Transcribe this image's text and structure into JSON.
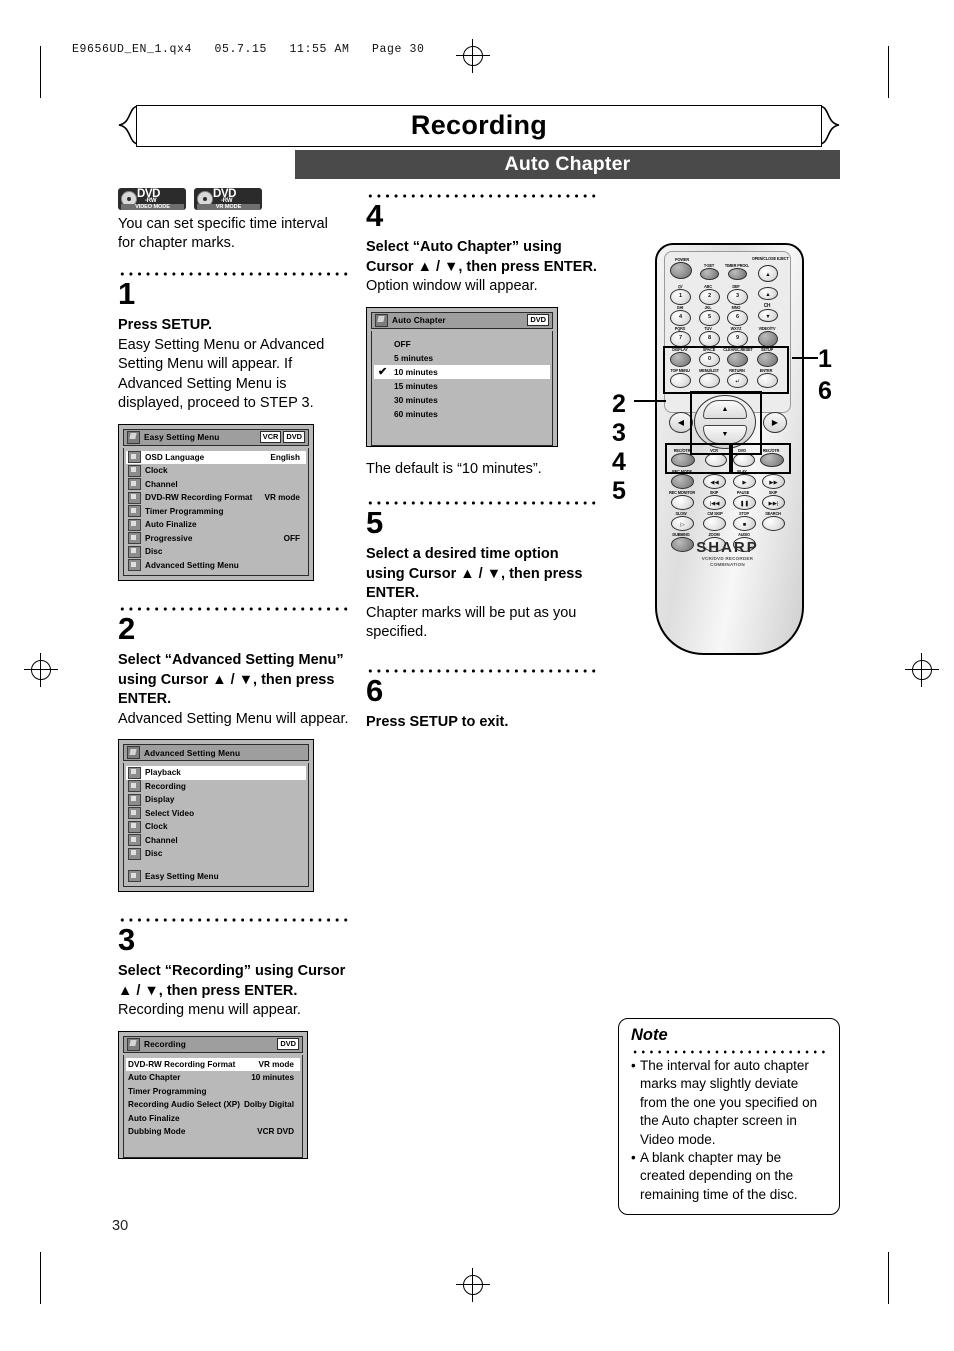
{
  "print_header": "E9656UD_EN_1.qx4   05.7.15   11:55 AM   Page 30",
  "page_number": "30",
  "header": {
    "chapter_title": "Recording",
    "section_title": "Auto Chapter"
  },
  "media_logos": [
    {
      "top": "DVD",
      "mid": "-RW",
      "bottom": "VIDEO MODE"
    },
    {
      "top": "DVD",
      "mid": "-RW",
      "bottom": "VR MODE"
    }
  ],
  "intro": "You can set specific time interval for chapter marks.",
  "steps": [
    {
      "number": "1",
      "bold": "Press SETUP.",
      "body": "Easy Setting Menu or Advanced Setting Menu will appear. If Advanced Setting Menu is displayed, proceed to STEP 3."
    },
    {
      "number": "2",
      "bold": "Select “Advanced Setting Menu” using Cursor ▲ / ▼, then press ENTER.",
      "body": "Advanced Setting Menu will appear."
    },
    {
      "number": "3",
      "bold": "Select “Recording” using Cursor ▲ / ▼, then press ENTER.",
      "body": "Recording menu will appear."
    },
    {
      "number": "4",
      "bold": "Select “Auto Chapter” using Cursor ▲ / ▼, then press ENTER.",
      "body": "Option window will appear."
    },
    {
      "number": "5",
      "bold": "Select a desired time option using Cursor ▲ / ▼, then press ENTER.",
      "body": "Chapter marks will be put as you specified."
    },
    {
      "number": "6",
      "bold": "Press SETUP to exit.",
      "body": ""
    }
  ],
  "default_note": "The default is “10 minutes”.",
  "screens": {
    "easy_setting": {
      "title": "Easy Setting Menu",
      "tags": [
        "VCR",
        "DVD"
      ],
      "rows": [
        {
          "label": "OSD Language",
          "value": "English",
          "selected": true
        },
        {
          "label": "Clock",
          "value": "",
          "selected": false
        },
        {
          "label": "Channel",
          "value": "",
          "selected": false
        },
        {
          "label": "DVD-RW Recording Format",
          "value": "VR mode",
          "selected": false
        },
        {
          "label": "Timer Programming",
          "value": "",
          "selected": false
        },
        {
          "label": "Auto Finalize",
          "value": "",
          "selected": false
        },
        {
          "label": "Progressive",
          "value": "OFF",
          "selected": false
        },
        {
          "label": "Disc",
          "value": "",
          "selected": false
        },
        {
          "label": "Advanced Setting Menu",
          "value": "",
          "selected": false
        }
      ]
    },
    "advanced_setting": {
      "title": "Advanced Setting Menu",
      "tags": [],
      "rows": [
        {
          "label": "Playback",
          "value": "",
          "selected": true
        },
        {
          "label": "Recording",
          "value": "",
          "selected": false
        },
        {
          "label": "Display",
          "value": "",
          "selected": false
        },
        {
          "label": "Select Video",
          "value": "",
          "selected": false
        },
        {
          "label": "Clock",
          "value": "",
          "selected": false
        },
        {
          "label": "Channel",
          "value": "",
          "selected": false
        },
        {
          "label": "Disc",
          "value": "",
          "selected": false
        },
        {
          "label": "",
          "value": "",
          "selected": false
        },
        {
          "label": "Easy Setting Menu",
          "value": "",
          "selected": false
        }
      ]
    },
    "recording": {
      "title": "Recording",
      "tags": [
        "DVD"
      ],
      "rows": [
        {
          "label": "DVD-RW Recording Format",
          "value": "VR mode",
          "selected": true
        },
        {
          "label": "Auto Chapter",
          "value": "10 minutes",
          "selected": false
        },
        {
          "label": "Timer Programming",
          "value": "",
          "selected": false
        },
        {
          "label": "Recording Audio Select (XP)",
          "value": "Dolby Digital",
          "selected": false
        },
        {
          "label": "Auto Finalize",
          "value": "",
          "selected": false
        },
        {
          "label": "Dubbing Mode",
          "value": "VCR DVD",
          "selected": false
        }
      ]
    },
    "auto_chapter": {
      "title": "Auto Chapter",
      "tags": [
        "DVD"
      ],
      "options": [
        {
          "label": "OFF",
          "selected": false,
          "checked": false
        },
        {
          "label": "5 minutes",
          "selected": false,
          "checked": false
        },
        {
          "label": "10 minutes",
          "selected": true,
          "checked": true
        },
        {
          "label": "15 minutes",
          "selected": false,
          "checked": false
        },
        {
          "label": "30 minutes",
          "selected": false,
          "checked": false
        },
        {
          "label": "60 minutes",
          "selected": false,
          "checked": false
        }
      ]
    }
  },
  "remote": {
    "brand": "SHARP",
    "brand_sub_line1": "VCR/DVD RECORDER",
    "brand_sub_line2": "COMBINATION",
    "callouts_left": [
      "2",
      "3",
      "4",
      "5"
    ],
    "callouts_right": [
      "1",
      "6"
    ],
    "buttons": [
      {
        "label": "POWER"
      },
      {
        "label": "T-SET"
      },
      {
        "label": "TIMER PROG."
      },
      {
        "label": "OPEN/CLOSE EJECT"
      },
      {
        "label": "@/",
        "num": "1"
      },
      {
        "label": "ABC",
        "num": "2"
      },
      {
        "label": "DEF",
        "num": "3"
      },
      {
        "label": "GHI",
        "num": "4"
      },
      {
        "label": "JKL",
        "num": "5"
      },
      {
        "label": "MNO",
        "num": "6"
      },
      {
        "label": "PQRS",
        "num": "7"
      },
      {
        "label": "TUV",
        "num": "8"
      },
      {
        "label": "WXYZ",
        "num": "9"
      },
      {
        "label": "VIDEO/TV"
      },
      {
        "label": "CH"
      },
      {
        "label": "DISPLAY"
      },
      {
        "label": "SPACE",
        "num": "0"
      },
      {
        "label": "CLEAR/C.RESET"
      },
      {
        "label": "SETUP"
      },
      {
        "label": "TOP MENU"
      },
      {
        "label": "MENU/LIST"
      },
      {
        "label": "RETURN"
      },
      {
        "label": "ENTER"
      },
      {
        "label": "REC/OTR"
      },
      {
        "label": "VCR"
      },
      {
        "label": "DVD"
      },
      {
        "label": "REC/OTR"
      },
      {
        "label": "REC MODE"
      },
      {
        "label": "PLAY"
      },
      {
        "label": "REC MONITOR"
      },
      {
        "label": "SKIP"
      },
      {
        "label": "PAUSE"
      },
      {
        "label": "SKIP"
      },
      {
        "label": "SLOW"
      },
      {
        "label": "CM SKIP"
      },
      {
        "label": "STOP"
      },
      {
        "label": "SEARCH"
      },
      {
        "label": "DUBBING"
      },
      {
        "label": "ZOOM"
      },
      {
        "label": "AUDIO"
      }
    ]
  },
  "note": {
    "heading": "Note",
    "items": [
      "The interval for auto chapter marks may slightly deviate from the one you specified on the Auto chapter screen in Video mode.",
      "A blank chapter may be created depending on the remaining time of the disc."
    ]
  }
}
